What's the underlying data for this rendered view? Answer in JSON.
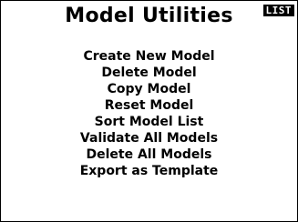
{
  "header": {
    "title": "Model Utilities",
    "badge": "LIST"
  },
  "menu": {
    "items": [
      {
        "label": "Create New Model"
      },
      {
        "label": "Delete Model"
      },
      {
        "label": "Copy Model"
      },
      {
        "label": "Reset Model"
      },
      {
        "label": "Sort Model List"
      },
      {
        "label": "Validate All Models"
      },
      {
        "label": "Delete All Models"
      },
      {
        "label": "Export as Template"
      }
    ]
  }
}
